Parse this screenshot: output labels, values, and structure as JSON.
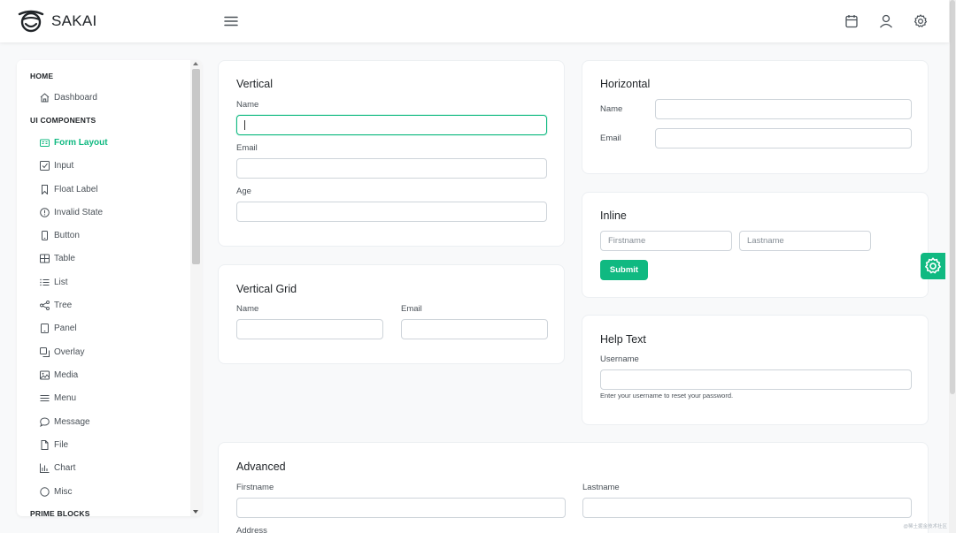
{
  "app": {
    "brand": "SAKAI",
    "accent": "#10b981"
  },
  "topbar": {
    "icons": [
      "calendar-icon",
      "user-icon",
      "settings-icon"
    ]
  },
  "sidebar": {
    "sections": [
      {
        "title": "HOME",
        "items": [
          {
            "label": "Dashboard",
            "icon": "home-icon"
          }
        ]
      },
      {
        "title": "UI COMPONENTS",
        "items": [
          {
            "label": "Form Layout",
            "icon": "id-card-icon",
            "active": true
          },
          {
            "label": "Input",
            "icon": "check-square-icon"
          },
          {
            "label": "Float Label",
            "icon": "bookmark-icon"
          },
          {
            "label": "Invalid State",
            "icon": "exclamation-circle-icon"
          },
          {
            "label": "Button",
            "icon": "mobile-icon"
          },
          {
            "label": "Table",
            "icon": "table-icon"
          },
          {
            "label": "List",
            "icon": "list-icon"
          },
          {
            "label": "Tree",
            "icon": "share-icon"
          },
          {
            "label": "Panel",
            "icon": "tablet-icon"
          },
          {
            "label": "Overlay",
            "icon": "clone-icon"
          },
          {
            "label": "Media",
            "icon": "image-icon"
          },
          {
            "label": "Menu",
            "icon": "bars-icon"
          },
          {
            "label": "Message",
            "icon": "comment-icon"
          },
          {
            "label": "File",
            "icon": "file-icon"
          },
          {
            "label": "Chart",
            "icon": "chart-bar-icon"
          },
          {
            "label": "Misc",
            "icon": "circle-icon"
          }
        ]
      },
      {
        "title": "PRIME BLOCKS",
        "items": []
      }
    ]
  },
  "vertical": {
    "title": "Vertical",
    "name_label": "Name",
    "name_value": "",
    "email_label": "Email",
    "email_value": "",
    "age_label": "Age",
    "age_value": ""
  },
  "vertical_grid": {
    "title": "Vertical Grid",
    "name_label": "Name",
    "email_label": "Email"
  },
  "horizontal": {
    "title": "Horizontal",
    "name_label": "Name",
    "email_label": "Email"
  },
  "inline": {
    "title": "Inline",
    "firstname_placeholder": "Firstname",
    "lastname_placeholder": "Lastname",
    "submit_label": "Submit"
  },
  "help_text": {
    "title": "Help Text",
    "username_label": "Username",
    "help": "Enter your username to reset your password."
  },
  "advanced": {
    "title": "Advanced",
    "firstname_label": "Firstname",
    "lastname_label": "Lastname",
    "address_label": "Address"
  },
  "watermark": "@稀土掘金技术社区"
}
